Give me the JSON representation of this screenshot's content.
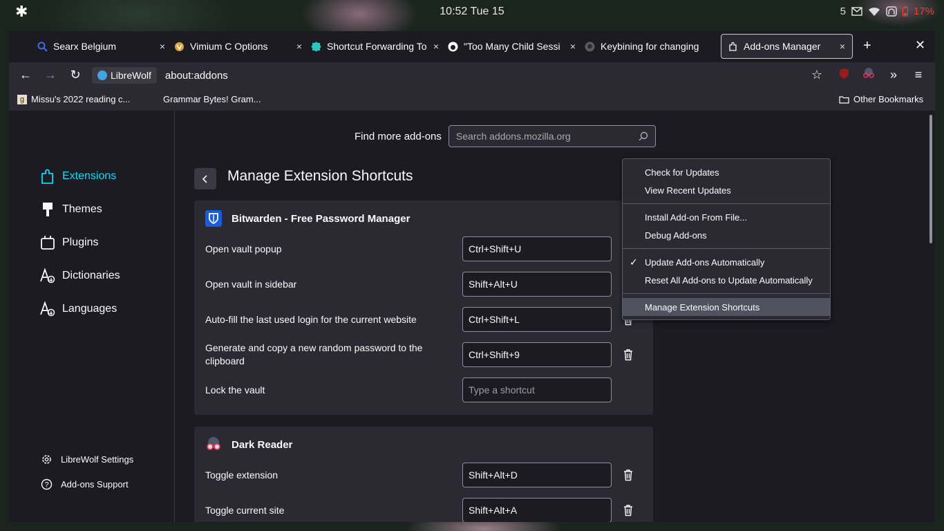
{
  "os": {
    "clock": "10:52 Tue 15",
    "notification_count": "5",
    "battery": "17%"
  },
  "tabs": [
    {
      "label": "Searx Belgium",
      "icon": "search-icon"
    },
    {
      "label": "Vimium C Options",
      "icon": "vimium-icon"
    },
    {
      "label": "Shortcut Forwarding To",
      "icon": "puzzle-icon"
    },
    {
      "label": "\"Too Many Child Sessi",
      "icon": "reddit-icon"
    },
    {
      "label": "Keybining for changing",
      "icon": "github-icon"
    },
    {
      "label": "Add-ons Manager",
      "icon": "puzzle-piece-icon"
    }
  ],
  "nav": {
    "identity_label": "LibreWolf",
    "url": "about:addons"
  },
  "bookmarks": {
    "items": [
      "Missu's 2022 reading c...",
      "Grammar Bytes! Gram..."
    ],
    "other": "Other Bookmarks"
  },
  "sidebar": {
    "categories": [
      "Extensions",
      "Themes",
      "Plugins",
      "Dictionaries",
      "Languages"
    ],
    "settings": "LibreWolf Settings",
    "support": "Add-ons Support"
  },
  "main": {
    "find_more": "Find more add-ons",
    "search_placeholder": "Search addons.mozilla.org",
    "title": "Manage Extension Shortcuts"
  },
  "extensions": [
    {
      "name": "Bitwarden - Free Password Manager",
      "shortcuts": [
        {
          "label": "Open vault popup",
          "value": "Ctrl+Shift+U"
        },
        {
          "label": "Open vault in sidebar",
          "value": "Shift+Alt+U"
        },
        {
          "label": "Auto-fill the last used login for the current website",
          "value": "Ctrl+Shift+L"
        },
        {
          "label": "Generate and copy a new random password to the clipboard",
          "value": "Ctrl+Shift+9"
        },
        {
          "label": "Lock the vault",
          "value": "",
          "placeholder": "Type a shortcut"
        }
      ]
    },
    {
      "name": "Dark Reader",
      "shortcuts": [
        {
          "label": "Toggle extension",
          "value": "Shift+Alt+D"
        },
        {
          "label": "Toggle current site",
          "value": "Shift+Alt+A"
        }
      ]
    }
  ],
  "menu": {
    "items": [
      "Check for Updates",
      "View Recent Updates",
      "Install Add-on From File...",
      "Debug Add-ons",
      "Update Add-ons Automatically",
      "Reset All Add-ons to Update Automatically",
      "Manage Extension Shortcuts"
    ]
  },
  "colors": {
    "accent": "#00ddff",
    "battery": "#e0452f",
    "bitwarden": "#175ddc"
  }
}
